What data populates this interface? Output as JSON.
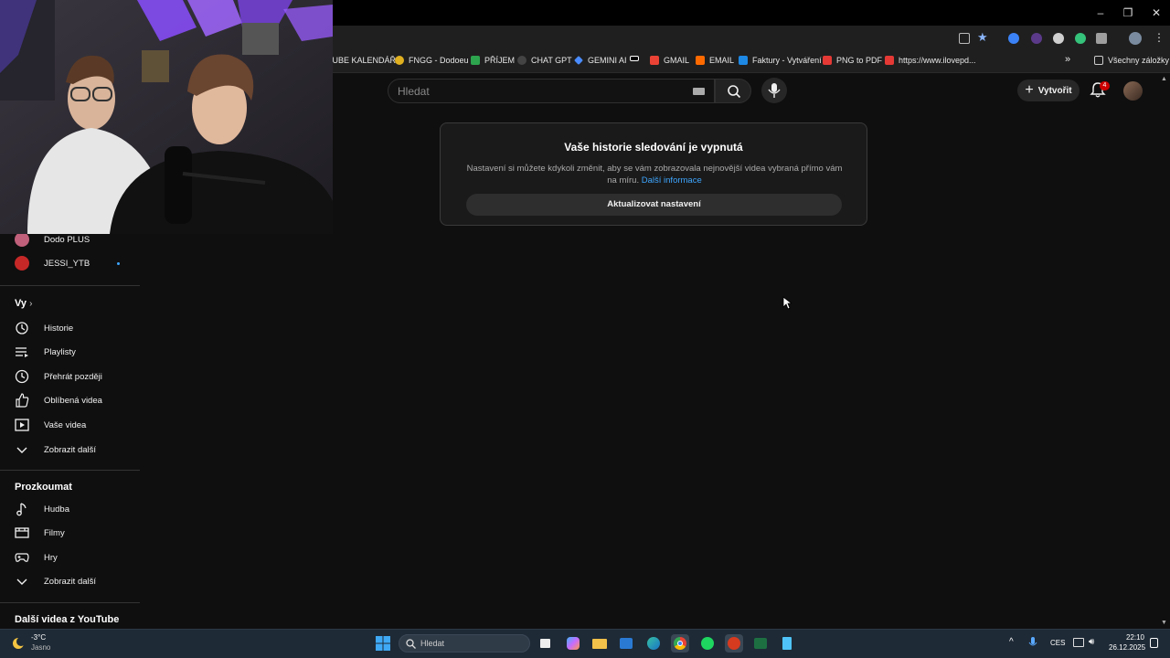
{
  "bookmarks": [
    {
      "label": "TUBE KALENDÁŘ",
      "color": "#ff3333"
    },
    {
      "label": "FNGG - Dodoeu",
      "color": "#e0b020"
    },
    {
      "label": "PŘÍJEM",
      "color": "#2da44e"
    },
    {
      "label": "CHAT GPT",
      "color": "#444444"
    },
    {
      "label": "GEMINI AI",
      "color": "#4a8cff"
    },
    {
      "label": "",
      "color": "#ffffff"
    },
    {
      "label": "GMAIL",
      "color": "#ea4335"
    },
    {
      "label": "EMAIL",
      "color": "#ff6a00"
    },
    {
      "label": "Faktury - Vytváření",
      "color": "#1e88e5"
    },
    {
      "label": "PNG to PDF",
      "color": "#e53935"
    },
    {
      "label": "https://www.ilovepd...",
      "color": "#e53935"
    }
  ],
  "bookmarks_more": "»",
  "all_bookmarks": "Všechny záložky",
  "search": {
    "placeholder": "Hledat"
  },
  "header": {
    "create_label": "Vytvořit",
    "notifications_count": "4"
  },
  "card": {
    "title": "Vaše historie sledování je vypnutá",
    "text": "Nastavení si můžete kdykoli změnit, aby se vám zobrazovala nejnovější videa vybraná přímo vám na míru.",
    "link": "Další informace",
    "button": "Aktualizovat nastavení"
  },
  "sidebar": {
    "channels": [
      {
        "label": "Dodo PLUS",
        "color": "#c0607a"
      },
      {
        "label": "JESSI_YTB",
        "color": "#c62828"
      }
    ],
    "you_heading": "Vy",
    "you_items": [
      {
        "label": "Historie",
        "icon": "history-icon"
      },
      {
        "label": "Playlisty",
        "icon": "playlist-icon"
      },
      {
        "label": "Přehrát později",
        "icon": "clock-icon"
      },
      {
        "label": "Oblíbená videa",
        "icon": "thumbs-up-icon"
      },
      {
        "label": "Vaše videa",
        "icon": "video-icon"
      },
      {
        "label": "Zobrazit další",
        "icon": "chevron-down-icon"
      }
    ],
    "explore_heading": "Prozkoumat",
    "explore_items": [
      {
        "label": "Hudba",
        "icon": "music-icon"
      },
      {
        "label": "Filmy",
        "icon": "film-icon"
      },
      {
        "label": "Hry",
        "icon": "gamepad-icon"
      },
      {
        "label": "Zobrazit další",
        "icon": "chevron-down-icon"
      }
    ],
    "more_heading": "Další videa z YouTube"
  },
  "taskbar": {
    "weather_temp": "-3°C",
    "weather_desc": "Jasno",
    "search_label": "Hledat",
    "lang": "CES",
    "time": "22:10",
    "date": "26.12.2025"
  }
}
